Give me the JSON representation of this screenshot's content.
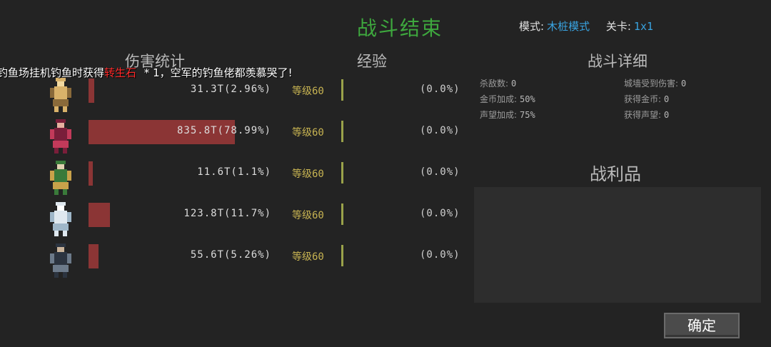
{
  "header": {
    "title": "战斗结束",
    "mode_label": "模式:",
    "mode_value": "木桩模式",
    "stage_label": "关卡:",
    "stage_value": "1x1"
  },
  "notice": {
    "prefix": "钓鱼场挂机钓鱼时获得",
    "item": "转生石",
    "star": "*",
    "count": "1",
    "suffix": "，空军的钓鱼佬都羡慕哭了!",
    "item_color": "#ff2a2a"
  },
  "sections": {
    "damage": "伤害统计",
    "exp": "经验",
    "detail": "战斗详细",
    "loot": "战利品"
  },
  "heroes": [
    {
      "portrait": "golden-dancer-sprite",
      "damage": "31.3T(2.96%)",
      "share": 0.0296,
      "level": "等级60",
      "exp": "(0.0%)"
    },
    {
      "portrait": "red-mage-sprite",
      "damage": "835.8T(78.99%)",
      "share": 0.7899,
      "level": "等级60",
      "exp": "(0.0%)"
    },
    {
      "portrait": "green-archer-sprite",
      "damage": "11.6T(1.1%)",
      "share": 0.011,
      "level": "等级60",
      "exp": "(0.0%)"
    },
    {
      "portrait": "white-ghost-sprite",
      "damage": "123.8T(11.7%)",
      "share": 0.117,
      "level": "等级60",
      "exp": "(0.0%)"
    },
    {
      "portrait": "dark-swordsman-sprite",
      "damage": "55.6T(5.26%)",
      "share": 0.0526,
      "level": "等级60",
      "exp": "(0.0%)"
    }
  ],
  "details": {
    "kills_label": "杀敌数:",
    "kills": "0",
    "wall_dmg_label": "城墙受到伤害:",
    "wall_dmg": "0",
    "gold_bonus_label": "金币加成:",
    "gold_bonus": "50%",
    "gold_gain_label": "获得金币:",
    "gold_gain": "0",
    "rep_bonus_label": "声望加成:",
    "rep_bonus": "75%",
    "rep_gain_label": "获得声望:",
    "rep_gain": "0"
  },
  "buttons": {
    "confirm": "确定"
  },
  "colors": {
    "title": "#3ea83e",
    "accent_blue": "#39a3e0",
    "damage_bar": "#8b3535",
    "level_text": "#c8b452"
  }
}
